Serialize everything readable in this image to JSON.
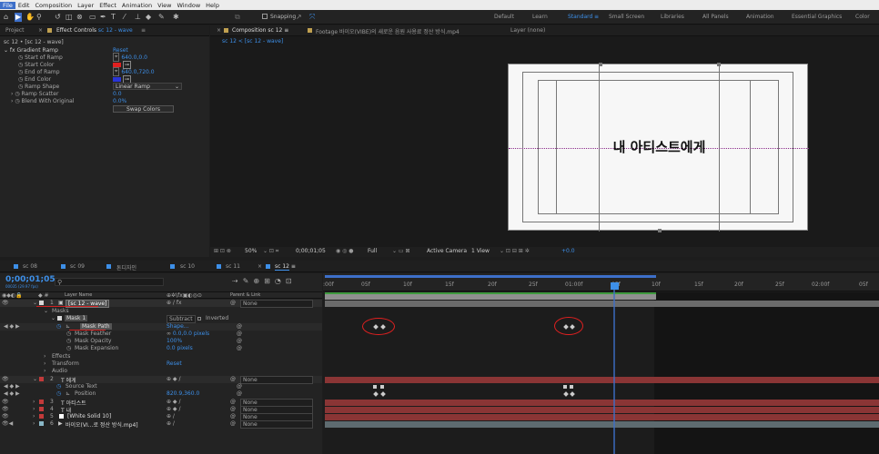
{
  "menu": [
    "File",
    "Edit",
    "Composition",
    "Layer",
    "Effect",
    "Animation",
    "View",
    "Window",
    "Help"
  ],
  "toolbar": {
    "snapping_label": "Snapping",
    "workspaces": [
      "Default",
      "Learn",
      "Standard",
      "Small Screen",
      "Libraries",
      "All Panels",
      "Animation",
      "Essential Graphics",
      "Color"
    ],
    "active_workspace": "Standard"
  },
  "effect_panel": {
    "tabs": [
      "Project",
      "Effect Controls",
      "sc 12 - wave"
    ],
    "breadcrumb": "sc 12 • [sc 12 - wave]",
    "effect_name": "Gradient Ramp",
    "reset_label": "Reset",
    "props": [
      {
        "name": "Start of Ramp",
        "value": "640.0,0.0"
      },
      {
        "name": "Start Color",
        "value": ""
      },
      {
        "name": "End of Ramp",
        "value": "640.0,720.0"
      },
      {
        "name": "End Color",
        "value": ""
      },
      {
        "name": "Ramp Shape",
        "value": "Linear Ramp"
      },
      {
        "name": "Ramp Scatter",
        "value": "0.0"
      },
      {
        "name": "Blend With Original",
        "value": "0.0%"
      }
    ],
    "swap_colors": "Swap Colors",
    "colors": {
      "start": "#e02020",
      "end": "#2a35d6"
    }
  },
  "comp_panel": {
    "tabs": [
      "Composition sc 12",
      "Footage 바이오(VIBE)의 새로운 음원 사용료 정산 방식.mp4",
      "Layer (none)"
    ],
    "subtab": "sc 12 < [sc 12 - wave]",
    "canvas_text": "내 아티스트에게",
    "zoom": "50%",
    "time": "0;00;01;05",
    "resolution": "Full",
    "camera": "Active Camera",
    "view": "1 View",
    "exposure": "+0.0"
  },
  "timeline": {
    "tabs": [
      "sc 08",
      "sc 09",
      "톤디자인",
      "sc 10",
      "sc 11",
      "sc 12"
    ],
    "active_tab": "sc 12",
    "timecode": "0;00;01;05",
    "fps_label": "00035 (29.97 fps)",
    "header": {
      "layer_name": "Layer Name",
      "parent": "Parent & Link"
    },
    "ruler": [
      ":00f",
      "05f",
      "10f",
      "15f",
      "20f",
      "25f",
      "01:00f",
      "05f",
      "10f",
      "15f",
      "20f",
      "25f",
      "02:00f",
      "05f"
    ],
    "layers": [
      {
        "num": "1",
        "name": "[sc 12 - wave]",
        "parent": "None"
      },
      {
        "num": "2",
        "name": "T 에게",
        "parent": "None"
      },
      {
        "num": "3",
        "name": "T 아티스트",
        "parent": "None"
      },
      {
        "num": "4",
        "name": "T 내",
        "parent": "None"
      },
      {
        "num": "5",
        "name": "[White Solid 10]",
        "parent": "None"
      },
      {
        "num": "6",
        "name": "바이오(VI...로 정산 방식.mp4]",
        "parent": "None"
      }
    ],
    "masks_label": "Masks",
    "mask1": "Mask 1",
    "subtract": "Subtract",
    "inverted": "Inverted",
    "mask_path": "Mask Path",
    "shape": "Shape...",
    "mask_feather": "Mask Feather",
    "feather_val": "0.0,0.0 pixels",
    "mask_opacity": "Mask Opacity",
    "opacity_val": "100%",
    "mask_expansion": "Mask Expansion",
    "expansion_val": "0.0 pixels",
    "effects": "Effects",
    "transform": "Transform",
    "transform_reset": "Reset",
    "audio": "Audio",
    "source_text": "Source Text",
    "position": "Position",
    "position_val": "820.9,360.0"
  }
}
